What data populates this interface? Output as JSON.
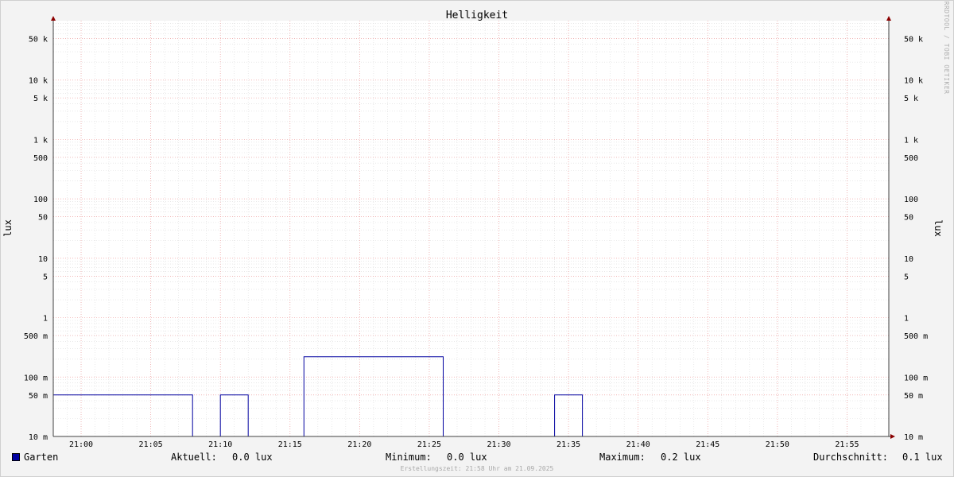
{
  "chart_data": {
    "type": "line",
    "title": "Helligkeit",
    "ylabel": "lux",
    "yscale": "log",
    "ylim": [
      0.01,
      100000
    ],
    "xlim": [
      "20:58",
      "21:58"
    ],
    "grid": true,
    "x_ticks": [
      "21:00",
      "21:05",
      "21:10",
      "21:15",
      "21:20",
      "21:25",
      "21:30",
      "21:35",
      "21:40",
      "21:45",
      "21:50",
      "21:55"
    ],
    "y_ticks": [
      {
        "value": 0.01,
        "label": "10 m"
      },
      {
        "value": 0.05,
        "label": "50 m"
      },
      {
        "value": 0.1,
        "label": "100 m"
      },
      {
        "value": 0.5,
        "label": "500 m"
      },
      {
        "value": 1,
        "label": "1"
      },
      {
        "value": 5,
        "label": "5"
      },
      {
        "value": 10,
        "label": "10"
      },
      {
        "value": 50,
        "label": "50"
      },
      {
        "value": 100,
        "label": "100"
      },
      {
        "value": 500,
        "label": "500"
      },
      {
        "value": 1000,
        "label": "1 k"
      },
      {
        "value": 5000,
        "label": "5 k"
      },
      {
        "value": 10000,
        "label": "10 k"
      },
      {
        "value": 50000,
        "label": "50 k"
      }
    ],
    "series": [
      {
        "name": "Garten",
        "color": "#0000a0",
        "points": [
          [
            "20:58",
            0.05
          ],
          [
            "21:08",
            0.05
          ],
          [
            "21:08",
            0.01
          ],
          [
            "21:10",
            0.01
          ],
          [
            "21:10",
            0.05
          ],
          [
            "21:12",
            0.05
          ],
          [
            "21:12",
            0.01
          ],
          [
            "21:16",
            0.01
          ],
          [
            "21:16",
            0.22
          ],
          [
            "21:26",
            0.22
          ],
          [
            "21:26",
            0.01
          ],
          [
            "21:34",
            0.01
          ],
          [
            "21:34",
            0.05
          ],
          [
            "21:36",
            0.05
          ],
          [
            "21:36",
            0.01
          ],
          [
            "21:58",
            0.01
          ]
        ]
      }
    ],
    "stats": {
      "aktuell_label": "Aktuell:",
      "aktuell_value": "0.0 lux",
      "minimum_label": "Minimum:",
      "minimum_value": "0.0 lux",
      "maximum_label": "Maximum:",
      "maximum_value": "0.2 lux",
      "durchschnitt_label": "Durchschnitt:",
      "durchschnitt_value": "0.1 lux"
    },
    "watermark": "RRDTOOL / TOBI OETIKER",
    "footer": "Erstellungszeit: 21:58 Uhr am 21.09.2025"
  }
}
